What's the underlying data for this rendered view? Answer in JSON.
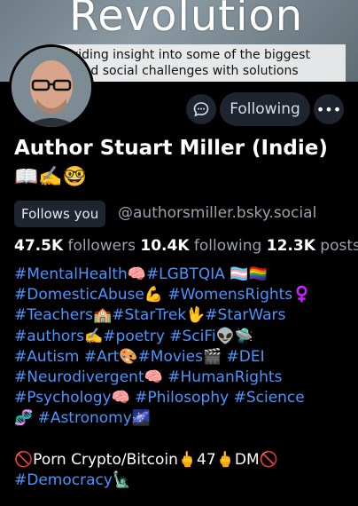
{
  "banner": {
    "title": "Revolution",
    "line1": "viding insight into some of the biggest",
    "line2": "al and social challenges with solutions"
  },
  "actions": {
    "following_label": "Following",
    "message_icon": "chat-bubble-icon",
    "more_icon": "ellipsis-icon"
  },
  "profile": {
    "display_name": "Author Stuart Miller (Indie)",
    "name_emojis": "📖✍️🤓",
    "follows_you": "Follows you",
    "handle": "@authorsmiller.bsky.social"
  },
  "stats": {
    "followers_count": "47.5K",
    "followers_label": "followers",
    "following_count": "10.4K",
    "following_label": "following",
    "posts_count": "12.3K",
    "posts_label": "posts"
  },
  "bio": {
    "lines": [
      "#MentalHealth🧠#LGBTQIA 🏳️‍⚧️🏳️‍🌈",
      "#DomesticAbuse💪 #WomensRights♀️",
      "#Teachers🏫#StarTrek🖖#StarWars",
      "#authors✍️#poetry #SciFi👽🛸",
      "#Autism #Art🎨#Movies🎬 #DEI",
      "#Neurodivergent🧠 #HumanRights",
      "#Psychology🧠 #Philosophy #Science",
      "🧬 #Astronomy🌌"
    ],
    "plain_line": "🚫Porn Crypto/Bitcoin🖕47🖕DM🚫",
    "last_line": "#Democracy🗽"
  },
  "colors": {
    "background": "#000000",
    "link": "#4a95ff",
    "muted": "#9aa3ae",
    "button_bg": "#1e2430"
  }
}
